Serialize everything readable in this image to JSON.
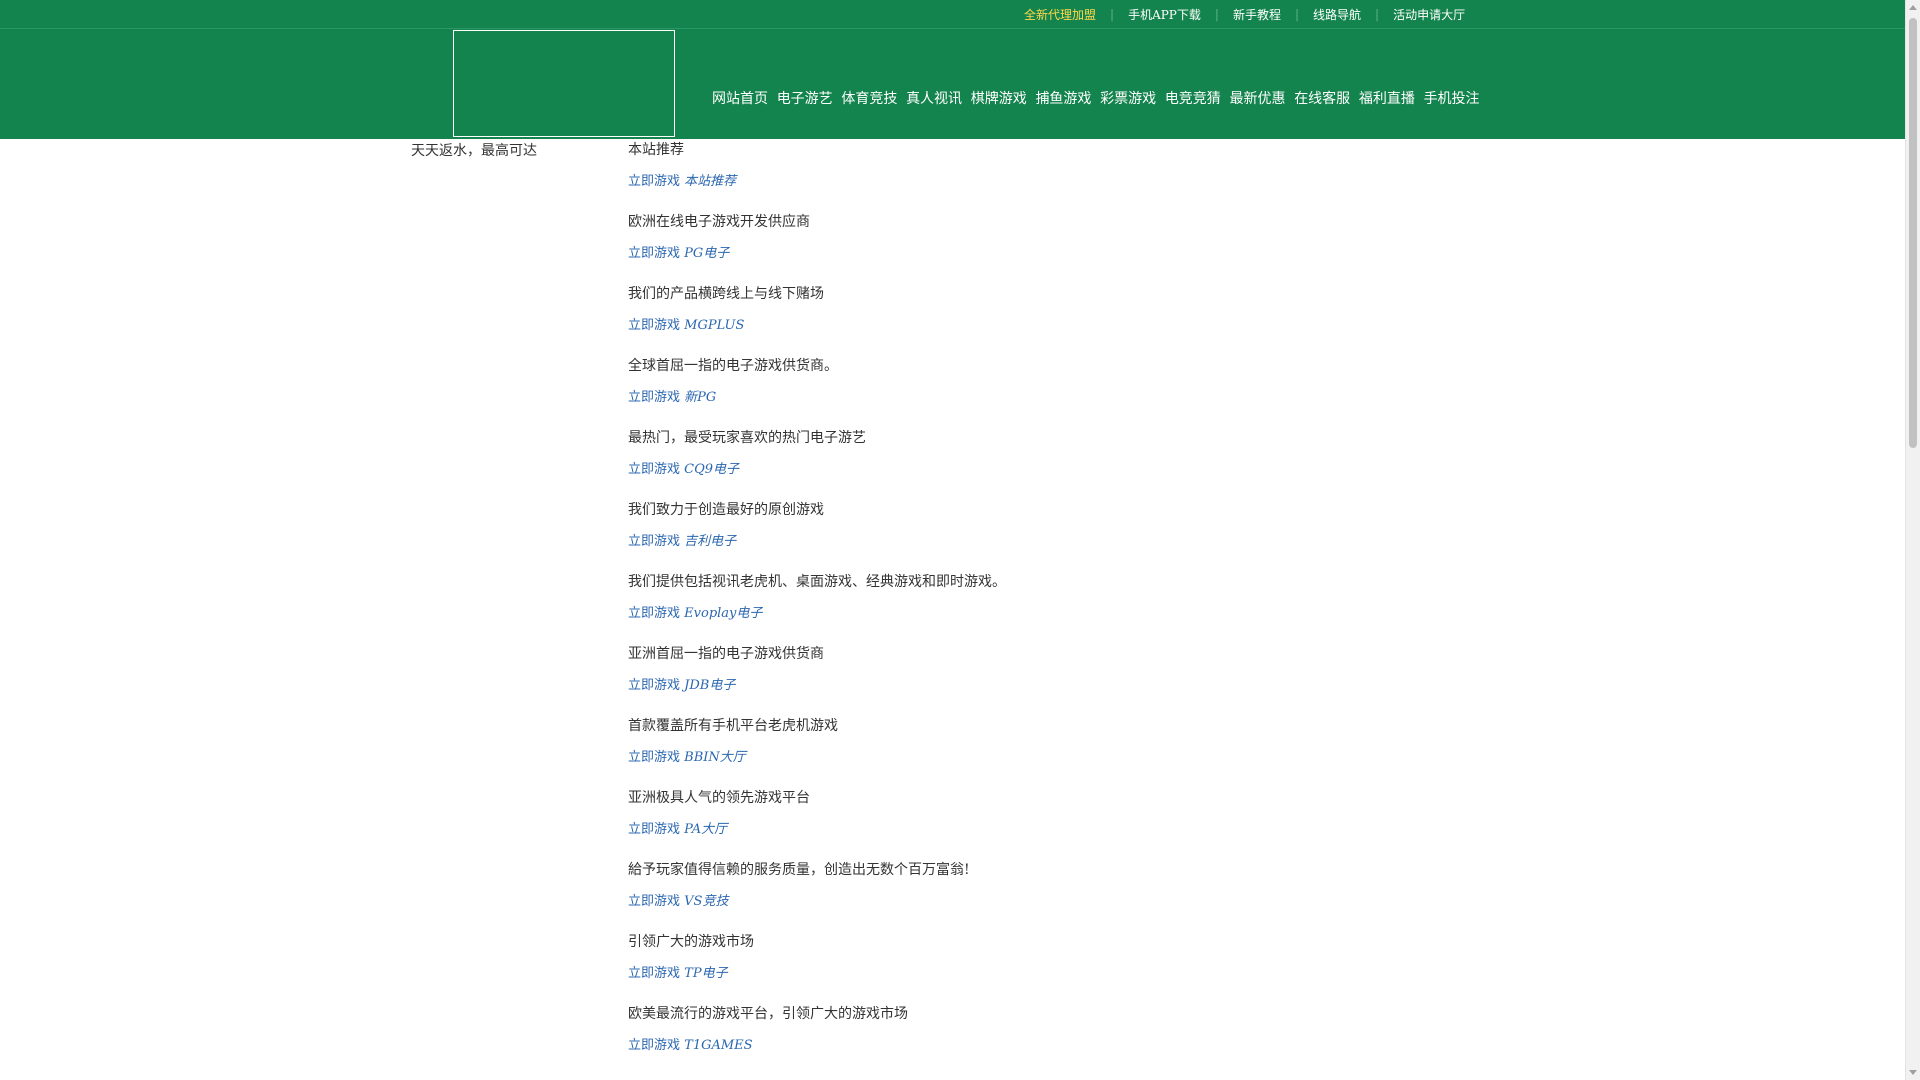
{
  "top_links": [
    "全新代理加盟",
    "手机APP下载",
    "新手教程",
    "线路导航",
    "活动申请大厅"
  ],
  "nav": [
    "网站首页",
    "电子游艺",
    "体育竞技",
    "真人视讯",
    "棋牌游戏",
    "捕鱼游戏",
    "彩票游戏",
    "电竞竞猜",
    "最新优惠",
    "在线客服",
    "福利直播",
    "手机投注"
  ],
  "sidebar": {
    "promo_text": "天天返水，最高可达"
  },
  "main": {
    "featured_title": "本站推荐",
    "play_prefix": "立即游戏",
    "games": [
      {
        "name": "本站推荐",
        "desc": "欧洲在线电子游戏开发供应商"
      },
      {
        "name": "PG电子",
        "desc": "我们的产品横跨线上与线下赌场"
      },
      {
        "name": "MGPLUS",
        "desc": "全球首屈一指的电子游戏供货商。"
      },
      {
        "name": "新PG",
        "desc": "最热门，最受玩家喜欢的热门电子游艺"
      },
      {
        "name": "CQ9电子",
        "desc": "我们致力于创造最好的原创游戏"
      },
      {
        "name": "吉利电子",
        "desc": "我们提供包括视讯老虎机、桌面游戏、经典游戏和即时游戏。"
      },
      {
        "name": "Evoplay电子",
        "desc": "亚洲首屈一指的电子游戏供货商"
      },
      {
        "name": "JDB电子",
        "desc": "首款覆盖所有手机平台老虎机游戏"
      },
      {
        "name": "BBIN大厅",
        "desc": "亚洲极具人气的领先游戏平台"
      },
      {
        "name": "PA大厅",
        "desc": "給予玩家值得信赖的服务质量，创造出无数个百万富翁!"
      },
      {
        "name": "VS竞技",
        "desc": "引领广大的游戏市场"
      },
      {
        "name": "TP电子",
        "desc": "欧美最流行的游戏平台，引领广大的游戏市场"
      },
      {
        "name": "T1GAMES",
        "desc": ""
      }
    ]
  },
  "colors": {
    "header_bg": "#13844d",
    "highlight_link": "#ffd84d",
    "play_link": "#2b67b0",
    "body_text": "#333333"
  }
}
